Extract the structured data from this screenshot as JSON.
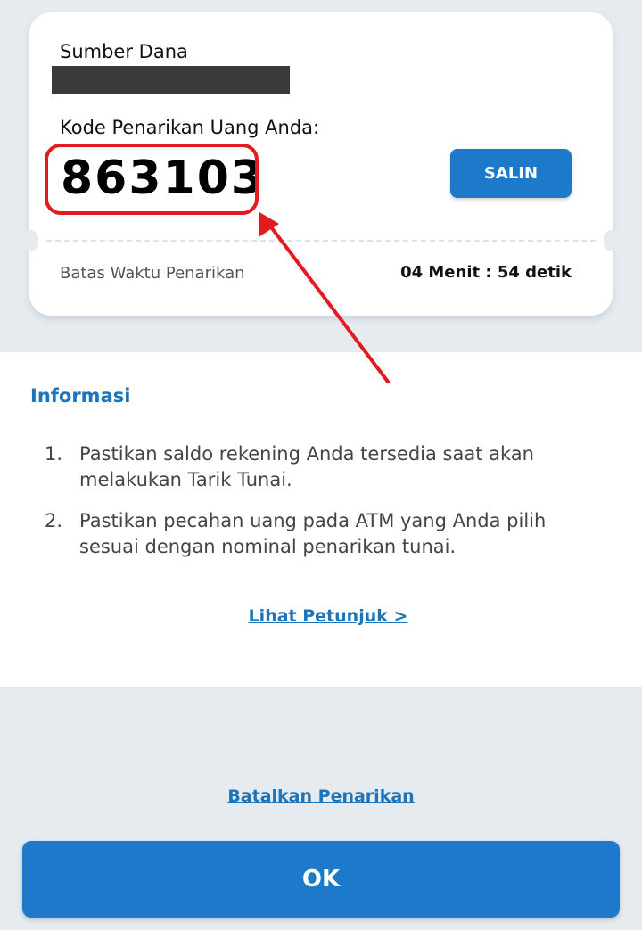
{
  "card": {
    "source_label": "Sumber Dana",
    "code_label": "Kode Penarikan Uang Anda:",
    "code_value": "863103",
    "copy_button": "SALIN",
    "deadline_label": "Batas Waktu Penarikan",
    "deadline_value": "04 Menit : 54 detik"
  },
  "info": {
    "title": "Informasi",
    "items": [
      {
        "num": "1.",
        "text": "Pastikan saldo rekening Anda tersedia saat akan melakukan Tarik Tunai."
      },
      {
        "num": "2.",
        "text": "Pastikan pecahan uang pada ATM yang Anda pilih sesuai dengan nominal penarikan tunai."
      }
    ],
    "guide_link": "Lihat Petunjuk >"
  },
  "actions": {
    "cancel_link": "Batalkan Penarikan",
    "ok_button": "OK"
  },
  "colors": {
    "primary": "#1d7acb",
    "link": "#1d74b8",
    "highlight": "#e21a22",
    "background": "#e6ebf0"
  }
}
